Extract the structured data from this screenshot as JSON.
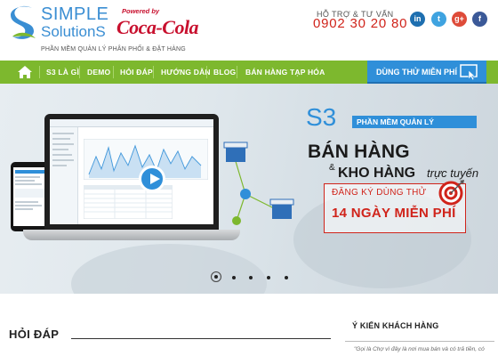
{
  "brand": {
    "name_line1": "SIMPLE",
    "name_line2": "SolutionS",
    "tagline": "PHẦN MỀM QUẢN LÝ PHÂN PHỐI & ĐẶT HÀNG",
    "partner_prefix": "Powered by",
    "partner_name": "Coca-Cola"
  },
  "contact": {
    "label": "HỖ TRỢ & TƯ VẤN",
    "phone": "0902 30 20 80"
  },
  "social": [
    "linkedin-icon",
    "twitter-icon",
    "google-plus-icon",
    "facebook-icon"
  ],
  "nav": {
    "items": [
      "S3 LÀ GÌ",
      "DEMO",
      "HỎI ĐÁP",
      "HƯỚNG DẪN",
      "BLOG",
      "BÁN HÀNG TẠP HÓA"
    ],
    "cta": "DÙNG THỬ MIỄN PHÍ"
  },
  "hero": {
    "product_code": "S3",
    "product_badge": "PHẦN MỀM QUẢN LÝ",
    "headline1": "BÁN HÀNG",
    "ampersand": "&",
    "headline2": "KHO HÀNG",
    "headline2_suffix": "trực tuyến",
    "register_line1": "ĐĂNG KÝ DÙNG THỬ",
    "register_line2": "14 NGÀY MIỄN PHÍ",
    "slide_count": 5,
    "active_slide": 1
  },
  "sections": {
    "faq_title": "HỎI ĐÁP",
    "reviews_title": "Ý KIẾN KHÁCH HÀNG",
    "review_snippet": "\"Gọi là Chợ vì đây là nơi mua bán và có trả tiền, có"
  },
  "colors": {
    "nav_green": "#7db82e",
    "accent_blue": "#2f8fd9",
    "accent_red": "#d0241b"
  }
}
